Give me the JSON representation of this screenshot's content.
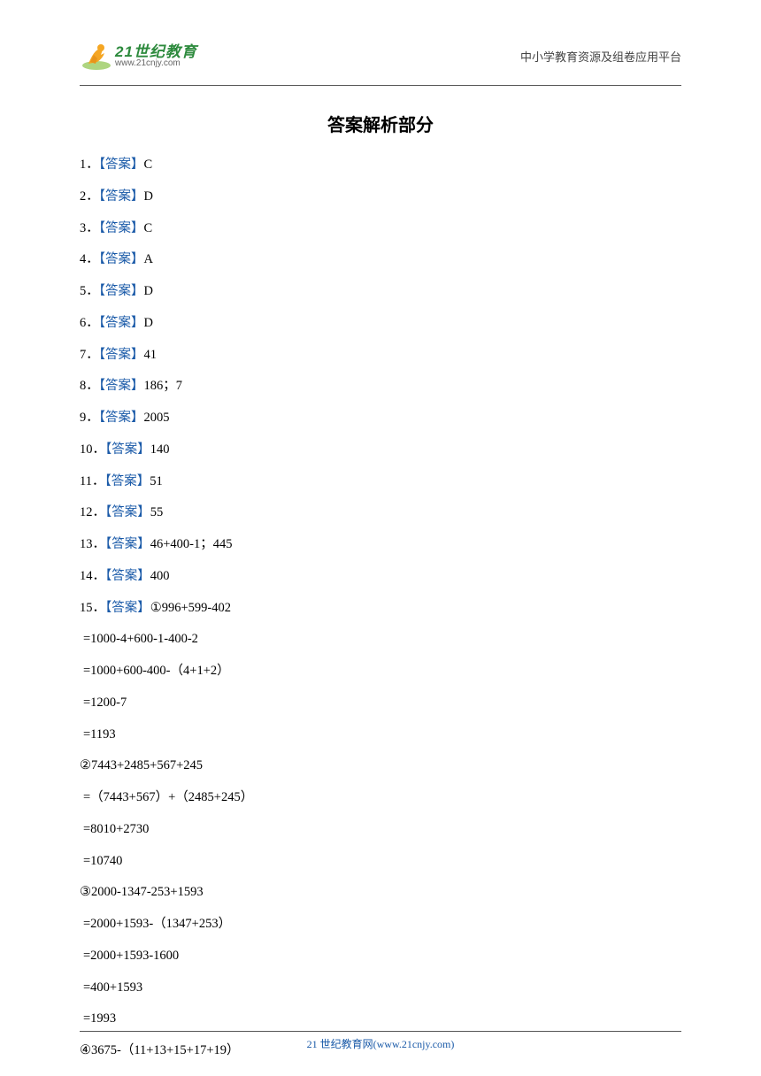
{
  "header": {
    "logo_cn": "21世纪教育",
    "logo_url": "www.21cnjy.com",
    "right_text": "中小学教育资源及组卷应用平台"
  },
  "title": "答案解析部分",
  "answer_label": "【答案】",
  "answers": [
    {
      "num": "1．",
      "value": "C"
    },
    {
      "num": "2．",
      "value": "D"
    },
    {
      "num": "3．",
      "value": "C"
    },
    {
      "num": "4．",
      "value": "A"
    },
    {
      "num": "5．",
      "value": "D"
    },
    {
      "num": "6．",
      "value": "D"
    },
    {
      "num": "7．",
      "value": "41"
    },
    {
      "num": "8．",
      "value": "186；7"
    },
    {
      "num": "9．",
      "value": "2005"
    },
    {
      "num": "10．",
      "value": "140"
    },
    {
      "num": "11．",
      "value": "51"
    },
    {
      "num": "12．",
      "value": "55"
    },
    {
      "num": "13．",
      "value": "46+400-1；445"
    },
    {
      "num": "14．",
      "value": "400"
    }
  ],
  "q15_num": "15．",
  "q15_prefix": "①996+599-402",
  "work": [
    " =1000-4+600-1-400-2",
    " =1000+600-400-（4+1+2）",
    " =1200-7",
    " =1193",
    "②7443+2485+567+245",
    " =（7443+567）+（2485+245）",
    " =8010+2730",
    " =10740",
    "③2000-1347-253+1593",
    " =2000+1593-（1347+253）",
    " =2000+1593-1600",
    " =400+1593",
    " =1993",
    "④3675-（11+13+15+17+19）"
  ],
  "footer": "21 世纪教育网(www.21cnjy.com)"
}
